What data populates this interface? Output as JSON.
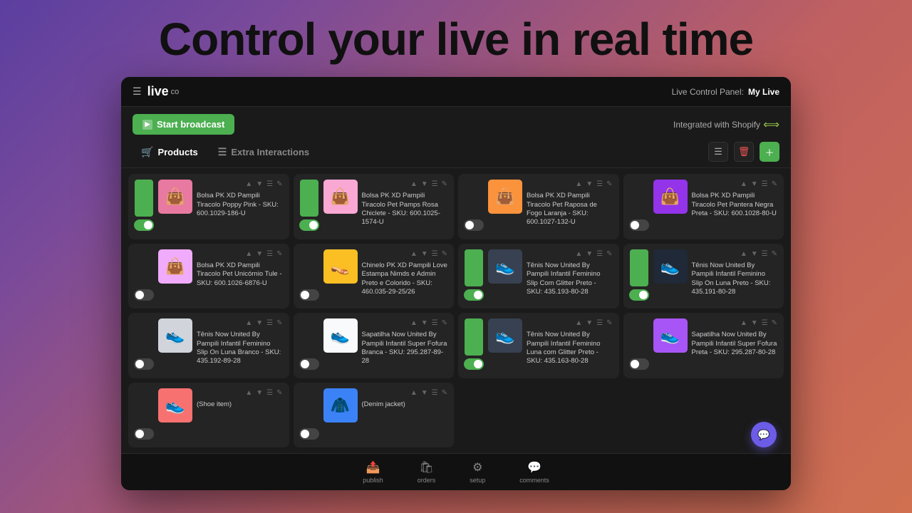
{
  "hero": {
    "title": "Control your live in real time"
  },
  "header": {
    "logo": "live",
    "logo_suffix": "co",
    "panel_label": "Live Control Panel:",
    "panel_name": "My Live"
  },
  "toolbar": {
    "start_broadcast": "Start broadcast",
    "shopify_label": "Integrated with Shopify"
  },
  "tabs": {
    "products_label": "Products",
    "extra_label": "Extra Interactions"
  },
  "products": [
    {
      "name": "Bolsa PK XD Pampili Tiracolo Poppy Pink - SKU: 600.1029-186-U",
      "active": true,
      "emoji": "👜",
      "color": "#e879a0"
    },
    {
      "name": "Bolsa PK XD Pampili Tiracolo Pet Pamps Rosa Chiclete - SKU: 600.1025-1574-U",
      "active": true,
      "emoji": "👜",
      "color": "#f9a8d4"
    },
    {
      "name": "Bolsa PK XD Pampili Tiracolo Pet Raposa de Fogo Laranja - SKU: 600.1027-132-U",
      "active": false,
      "emoji": "👜",
      "color": "#fb923c"
    },
    {
      "name": "Bolsa PK XD Pampili Tiracolo Pet Pantera Negra Preta - SKU: 600.1028-80-U",
      "active": false,
      "emoji": "👜",
      "color": "#9333ea"
    },
    {
      "name": "Bolsa PK XD Pampili Tiracolo Pet Unicórnio Tule - SKU: 600.1026-6876-U",
      "active": false,
      "emoji": "👜",
      "color": "#f0abfc"
    },
    {
      "name": "Chinelo PK XD Pampili Love Estampa Nimds e Admin Preto e Colorido - SKU: 460.035-29-25/26",
      "active": false,
      "emoji": "👡",
      "color": "#fbbf24"
    },
    {
      "name": "Tênis Now United By Pampili Infantil Feminino Slip Com Glitter Preto - SKU: 435.193-80-28",
      "active": true,
      "emoji": "👟",
      "color": "#374151"
    },
    {
      "name": "Tênis Now United By Pampili Infantil Feminino Slip On Luna Preto - SKU: 435.191-80-28",
      "active": true,
      "emoji": "👟",
      "color": "#1f2937"
    },
    {
      "name": "Tênis Now United By Pampili Infantil Feminino Slip On Luna Branco - SKU: 435.192-89-28",
      "active": false,
      "emoji": "👟",
      "color": "#d1d5db"
    },
    {
      "name": "Sapatilha Now United By Pampili Infantil Super Fofura Branca - SKU: 295.287-89-28",
      "active": false,
      "emoji": "👟",
      "color": "#f9fafb"
    },
    {
      "name": "Tênis Now United By Pampili Infantil Feminino Luna com Glitter Preto - SKU: 435.163-80-28",
      "active": true,
      "emoji": "👟",
      "color": "#374151"
    },
    {
      "name": "Sapatilha Now United By Pampili Infantil Super Fofura Preta - SKU: 295.287-80-28",
      "active": false,
      "emoji": "👟",
      "color": "#a855f7"
    },
    {
      "name": "(Shoe item)",
      "active": false,
      "emoji": "👟",
      "color": "#f87171"
    },
    {
      "name": "(Denim jacket)",
      "active": false,
      "emoji": "🧥",
      "color": "#3b82f6"
    }
  ],
  "bottom_nav": [
    {
      "label": "publish",
      "icon": "📤",
      "active": false
    },
    {
      "label": "orders",
      "icon": "🛍",
      "active": false
    },
    {
      "label": "setup",
      "icon": "⚙",
      "active": false
    },
    {
      "label": "comments",
      "icon": "💬",
      "active": false
    }
  ]
}
